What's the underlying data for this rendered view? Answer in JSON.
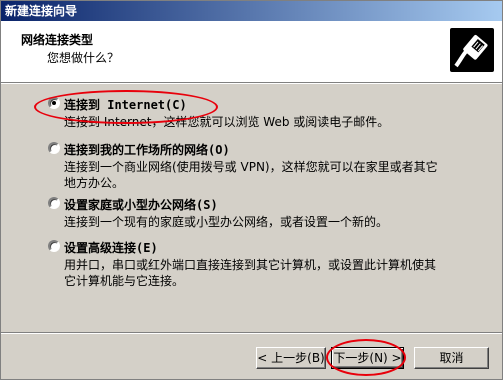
{
  "window": {
    "title": "新建连接向导"
  },
  "header": {
    "title": "网络连接类型",
    "subtitle": "您想做什么？",
    "icon": "network-cable-icon"
  },
  "options": [
    {
      "label": "连接到 Internet(C)",
      "description": "连接到 Internet，这样您就可以浏览 Web 或阅读电子邮件。",
      "checked": true
    },
    {
      "label": "连接到我的工作场所的网络(O)",
      "description": "连接到一个商业网络(使用拨号或 VPN)，这样您就可以在家里或者其它地方办公。",
      "checked": false
    },
    {
      "label": "设置家庭或小型办公网络(S)",
      "description": "连接到一个现有的家庭或小型办公网络，或者设置一个新的。",
      "checked": false
    },
    {
      "label": "设置高级连接(E)",
      "description": "用并口，串口或红外端口直接连接到其它计算机，或设置此计算机使其它计算机能与它连接。",
      "checked": false
    }
  ],
  "buttons": {
    "back": "< 上一步(B)",
    "next": "下一步(N) >",
    "cancel": "取消"
  },
  "colors": {
    "title_start": "#0a246a",
    "title_end": "#a6caf0",
    "face": "#d4d0c8",
    "annotation": "#e8000b"
  }
}
